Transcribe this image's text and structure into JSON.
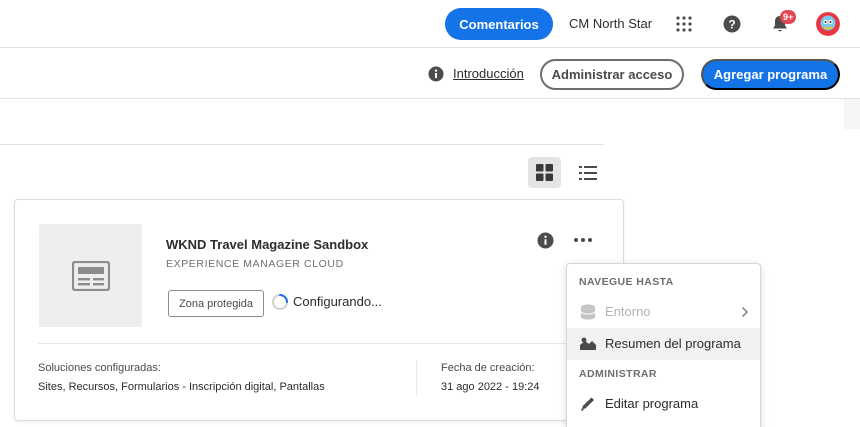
{
  "header": {
    "feedback_label": "Comentarios",
    "org_name": "CM North Star",
    "notification_badge": "9+",
    "apps_icon": "apps-grid-icon",
    "help_icon": "help-icon",
    "bell_icon": "bell-icon"
  },
  "subheader": {
    "intro_label": "Introducción",
    "manage_access_label": "Administrar acceso",
    "add_program_label": "Agregar programa"
  },
  "view_toggle": {
    "grid_icon": "grid-view-icon",
    "list_icon": "list-view-icon",
    "active": "grid"
  },
  "program_card": {
    "title": "WKND Travel Magazine Sandbox",
    "subtitle": "EXPERIENCE MANAGER CLOUD",
    "tag": "Zona protegida",
    "status": "Configurando...",
    "solutions_label": "Soluciones configuradas:",
    "solutions_value": "Sites, Recursos, Formularios - Inscripción digital, Pantallas",
    "created_label": "Fecha de creación:",
    "created_value": "31 ago 2022 - 19:24"
  },
  "menu": {
    "section_navigate": "NAVEGUE HASTA",
    "item_environment": "Entorno",
    "item_program_summary": "Resumen del programa",
    "section_manage": "ADMINISTRAR",
    "item_edit_program": "Editar programa"
  },
  "colors": {
    "accent": "#1473e6",
    "badge": "#e34850",
    "text": "#2c2c2c",
    "muted": "#6e6e6e"
  }
}
